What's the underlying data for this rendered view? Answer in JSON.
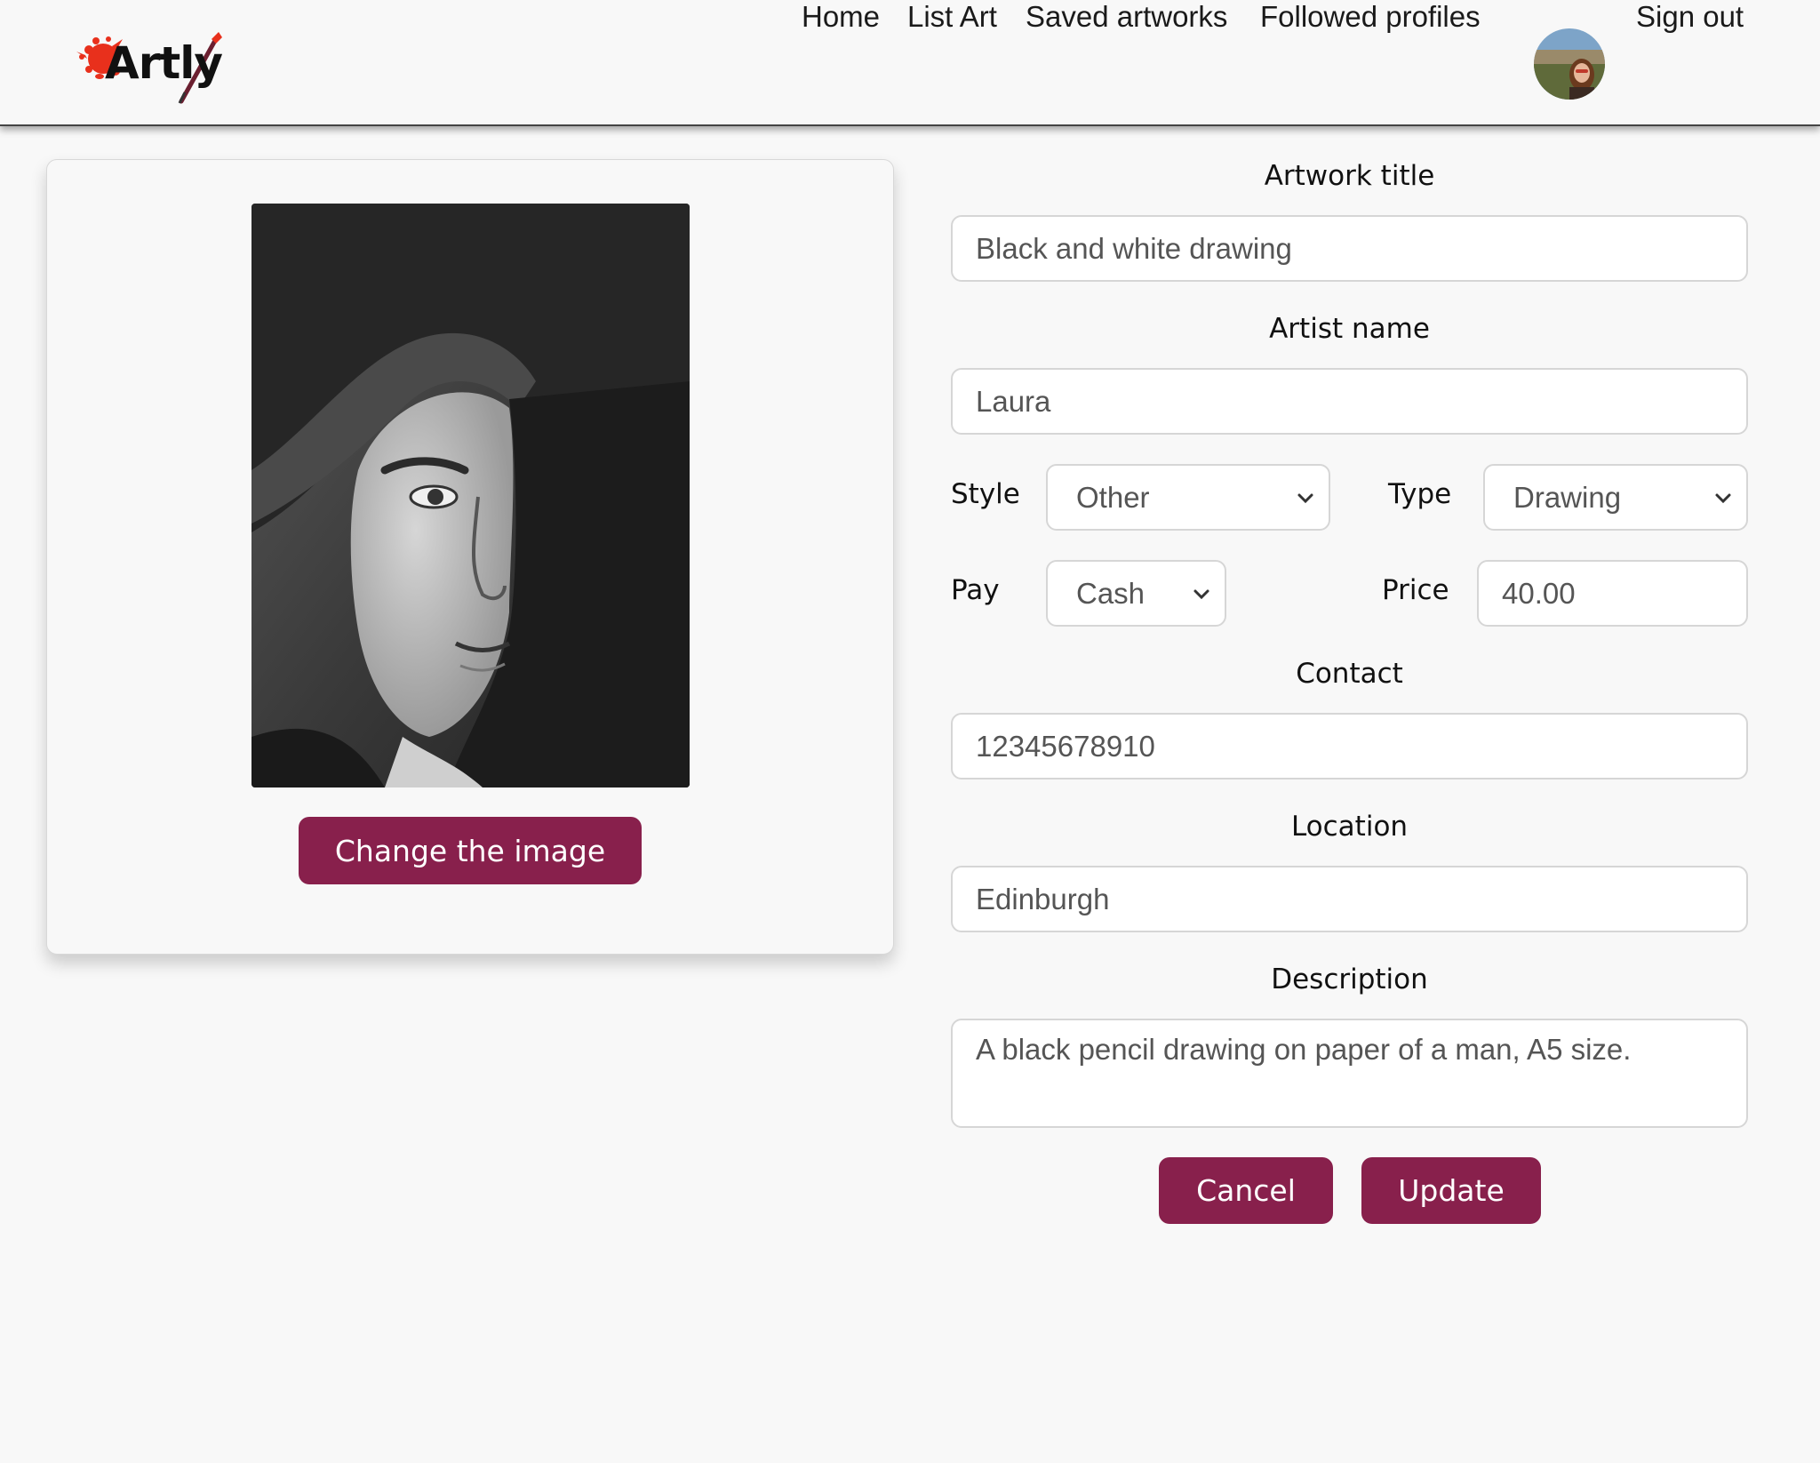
{
  "header": {
    "logo_text": "Artly",
    "nav": {
      "home": "Home",
      "list_art": "List Art",
      "saved_artworks": "Saved artworks",
      "followed_profiles": "Followed profiles",
      "sign_out": "Sign out"
    }
  },
  "image_panel": {
    "change_image_label": "Change the image"
  },
  "form": {
    "title_label": "Artwork title",
    "title_value": "Black and white drawing",
    "artist_label": "Artist name",
    "artist_value": "Laura",
    "style_label": "Style",
    "style_value": "Other",
    "type_label": "Type",
    "type_value": "Drawing",
    "pay_label": "Pay",
    "pay_value": "Cash",
    "price_label": "Price",
    "price_value": "40.00",
    "contact_label": "Contact",
    "contact_value": "12345678910",
    "location_label": "Location",
    "location_value": "Edinburgh",
    "description_label": "Description",
    "description_value": "A black pencil drawing on paper of a man, A5 size.",
    "cancel_label": "Cancel",
    "update_label": "Update"
  },
  "colors": {
    "primary_button": "#88204c",
    "background": "#f8f8f8",
    "logo_splash": "#e8301c"
  },
  "icons": [
    "paint-splash-logo",
    "paintbrush-logo",
    "chevron-down-icon",
    "user-avatar"
  ]
}
